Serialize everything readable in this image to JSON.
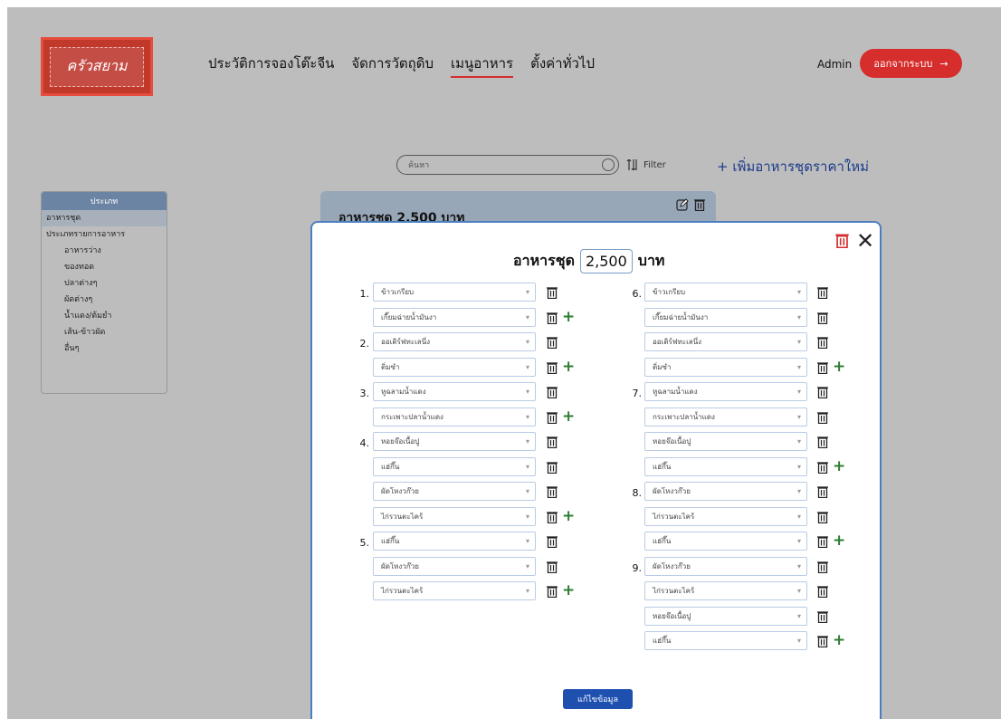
{
  "header": {
    "logo_text": "ครัวสยาม",
    "nav": [
      "ประวัติการจองโต๊ะจีน",
      "จัดการวัตถุดิบ",
      "เมนูอาหาร",
      "ตั้งค่าทั่วไป"
    ],
    "active_nav": "เมนูอาหาร",
    "user": "Admin",
    "logout_label": "ออกจากระบบ",
    "logout_arrow": "→"
  },
  "toolbar": {
    "search_placeholder": "ค้นหา",
    "filter_label": "Filter",
    "add_label": "+ เพิ่มอาหารชุดราคาใหม่"
  },
  "sidebar": {
    "title": "ประเภท",
    "items": [
      "อาหารชุด",
      "ประเภทรายการอาหาร"
    ],
    "subitems": [
      "อาหารว่าง",
      "ของทอด",
      "ปลาต่างๆ",
      "ผัดต่างๆ",
      "น้ำแดง/ต้มยำ",
      "เส้น-ข้าวผัด",
      "อื่นๆ"
    ]
  },
  "card": {
    "title": "อาหารชุด 2,500 บาท"
  },
  "modal": {
    "title_prefix": "อาหารชุด",
    "price": "2,500",
    "title_suffix": "บาท",
    "save_label": "แก้ไขข้อมูล",
    "close": "✕",
    "left_rows": [
      {
        "n": "1.",
        "v": "ข้าวเกรียบ",
        "plus": false
      },
      {
        "n": "",
        "v": "เกี๊ยมฉ่ายน้ำมันงา",
        "plus": true
      },
      {
        "n": "2.",
        "v": "ออเดิร์ฟทะเลนึ่ง",
        "plus": false
      },
      {
        "n": "",
        "v": "ติ่มซำ",
        "plus": true
      },
      {
        "n": "3.",
        "v": "หูฉลามน้ำแดง",
        "plus": false
      },
      {
        "n": "",
        "v": "กระเพาะปลาน้ำแดง",
        "plus": true
      },
      {
        "n": "4.",
        "v": "หอยจ๊อเนื้อปู",
        "plus": false
      },
      {
        "n": "",
        "v": "แฮ่กึ๊น",
        "plus": false
      },
      {
        "n": "",
        "v": "ผัดโหงวก๊วย",
        "plus": false
      },
      {
        "n": "",
        "v": "ไก่รวนตะไคร้",
        "plus": true
      },
      {
        "n": "5.",
        "v": "แฮ่กึ๊น",
        "plus": false
      },
      {
        "n": "",
        "v": "ผัดโหงวก๊วย",
        "plus": false
      },
      {
        "n": "",
        "v": "ไก่รวนตะไคร้",
        "plus": true
      }
    ],
    "right_rows": [
      {
        "n": "6.",
        "v": "ข้าวเกรียบ",
        "plus": false
      },
      {
        "n": "",
        "v": "เกี๊ยมฉ่ายน้ำมันงา",
        "plus": false
      },
      {
        "n": "",
        "v": "ออเดิร์ฟทะเลนึ่ง",
        "plus": false
      },
      {
        "n": "",
        "v": "ติ่มซำ",
        "plus": true
      },
      {
        "n": "7.",
        "v": "หูฉลามน้ำแดง",
        "plus": false
      },
      {
        "n": "",
        "v": "กระเพาะปลาน้ำแดง",
        "plus": false
      },
      {
        "n": "",
        "v": "หอยจ๊อเนื้อปู",
        "plus": false
      },
      {
        "n": "",
        "v": "แฮ่กึ๊น",
        "plus": true
      },
      {
        "n": "8.",
        "v": "ผัดโหงวก๊วย",
        "plus": false
      },
      {
        "n": "",
        "v": "ไก่รวนตะไคร้",
        "plus": false
      },
      {
        "n": "",
        "v": "แฮ่กึ๊น",
        "plus": true
      },
      {
        "n": "9.",
        "v": "ผัดโหงวก๊วย",
        "plus": false
      },
      {
        "n": "",
        "v": "ไก่รวนตะไคร้",
        "plus": false
      },
      {
        "n": "",
        "v": "หอยจ๊อเนื้อปู",
        "plus": false
      },
      {
        "n": "",
        "v": "แฮ่กึ๊น",
        "plus": true
      }
    ]
  },
  "colors": {
    "accent": "#d62d2d",
    "primary": "#1e50b0",
    "modal_border": "#4a7fbf"
  }
}
